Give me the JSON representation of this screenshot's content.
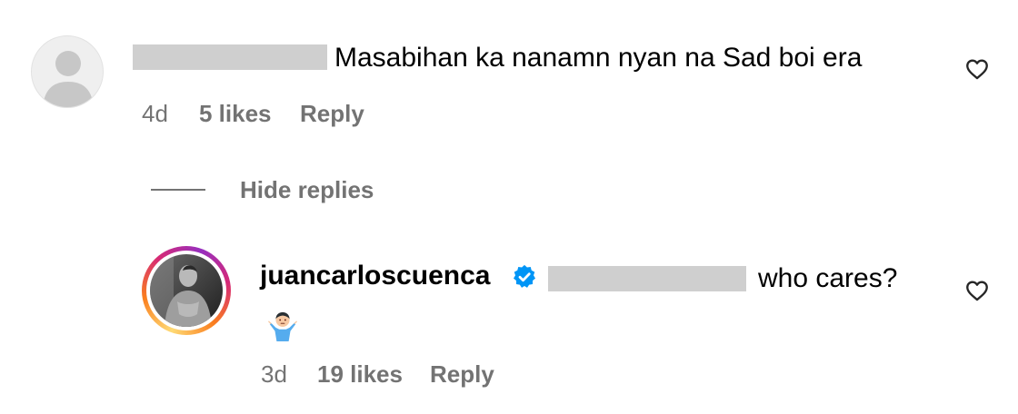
{
  "comment": {
    "text": "Masabihan ka nanamn nyan na Sad boi era",
    "meta": {
      "time": "4d",
      "likes": "5 likes",
      "reply_label": "Reply"
    },
    "heart_icon": "heart-outline-icon"
  },
  "thread": {
    "hide_replies_label": "Hide replies"
  },
  "reply": {
    "username": "juancarloscuenca",
    "verified_icon": "verified-badge-icon",
    "text": "who cares?",
    "emoji": "person-shrugging-emoji",
    "meta": {
      "time": "3d",
      "likes": "19 likes",
      "reply_label": "Reply"
    },
    "heart_icon": "heart-outline-icon"
  },
  "colors": {
    "text": "#000000",
    "secondary": "#737373",
    "verified": "#0095f6",
    "redacted": "#cfcfcf",
    "story_ring": [
      "#feda75",
      "#fa7e1e",
      "#d62976",
      "#962fbf"
    ]
  }
}
